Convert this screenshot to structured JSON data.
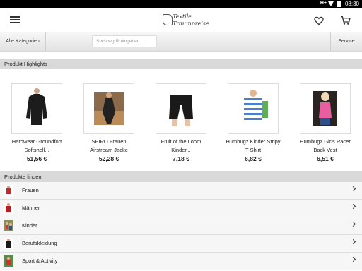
{
  "status_bar": {
    "signal": "H+",
    "time": "08:30"
  },
  "header": {
    "logo_line1": "Textile",
    "logo_line2": "Traumpreise"
  },
  "search_bar": {
    "categories_label": "Alle Kategorien",
    "search_placeholder": "Suchbegriff eingeben ...",
    "service_label": "Service"
  },
  "highlights": {
    "heading": "Produkt Highlights",
    "items": [
      {
        "name_line1": "Hardwear Groundfort",
        "name_line2": "Softshell...",
        "price": "51,56 €",
        "image": "black-jacket"
      },
      {
        "name_line1": "SPIRO Frauen",
        "name_line2": "Airstream Jacke",
        "price": "52,28 €",
        "image": "runner-jacket"
      },
      {
        "name_line1": "Fruit of the Loom",
        "name_line2": "Kinder...",
        "price": "7,18 €",
        "image": "kids-shorts"
      },
      {
        "name_line1": "Humbugz Kinder Stripy",
        "name_line2": "T-Shirt",
        "price": "6,82 €",
        "image": "striped-shirt"
      },
      {
        "name_line1": "Humbugz Girls Racer",
        "name_line2": "Back Vest",
        "price": "6,51 €",
        "image": "pink-vest"
      }
    ]
  },
  "find_products": {
    "heading": "Produkte finden",
    "categories": [
      {
        "label": "Frauen",
        "color": "#c8262c"
      },
      {
        "label": "Männer",
        "color": "#b51e22"
      },
      {
        "label": "Kinder",
        "color": "#6a7a3a"
      },
      {
        "label": "Berufskleidung",
        "color": "#1a1a1a"
      },
      {
        "label": "Sport & Activity",
        "color": "#2f6b2a"
      }
    ]
  }
}
